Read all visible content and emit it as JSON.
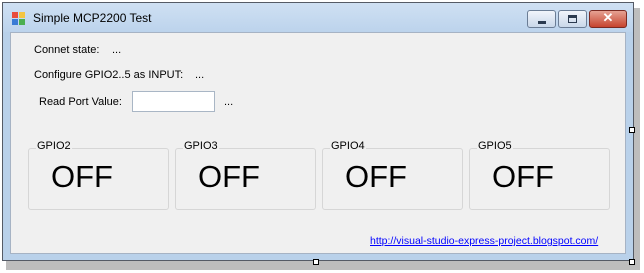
{
  "window": {
    "title": "Simple MCP2200 Test",
    "close_glyph": "✕"
  },
  "form": {
    "connect_state_label": "Connet state:",
    "connect_state_value": "...",
    "configure_label": "Configure GPIO2..5 as INPUT:",
    "configure_value": "...",
    "read_port_label": "Read Port Value:",
    "read_port_input_value": "",
    "read_port_status": "..."
  },
  "gpio": [
    {
      "label": "GPIO2",
      "state": "OFF"
    },
    {
      "label": "GPIO3",
      "state": "OFF"
    },
    {
      "label": "GPIO4",
      "state": "OFF"
    },
    {
      "label": "GPIO5",
      "state": "OFF"
    }
  ],
  "link": {
    "text": "http://visual-studio-express-project.blogspot.com/"
  },
  "colors": {
    "titlebar": "#bcd3ec",
    "client": "#f0f0f0",
    "link": "#0000ff",
    "close_button": "#c6432e"
  }
}
